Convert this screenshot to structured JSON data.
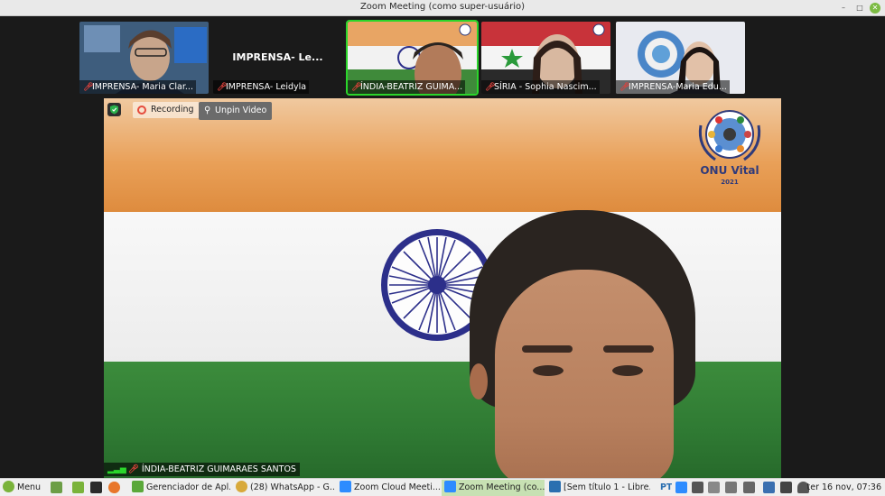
{
  "window": {
    "title": "Zoom Meeting (como super-usuário)"
  },
  "thumbnails": [
    {
      "name": "IMPRENSA- Maria Clar..."
    },
    {
      "big_name": "IMPRENSA- Le...",
      "name": "IMPRENSA- Leidyla"
    },
    {
      "name": "ÍNDIA-BEATRIZ GUIMA..."
    },
    {
      "name": "SÍRIA - Sophia Nascim..."
    },
    {
      "name": "IMPRENSA-Maria Edu..."
    }
  ],
  "main_video": {
    "recording_label": "Recording",
    "unpin_label": "Unpin Video",
    "participant_name": "ÍNDIA-BEATRIZ GUIMARAES SANTOS",
    "logo_title": "ONU Vital",
    "logo_year": "2021"
  },
  "taskbar": {
    "menu_label": "Menu",
    "apps": [
      {
        "label": "Gerenciador de Apl...",
        "icon_color": "#5aa83a"
      },
      {
        "label": "(28) WhatsApp - G...",
        "icon_color": "#d8a93a"
      },
      {
        "label": "Zoom Cloud Meeti...",
        "icon_color": "#2d8cff"
      },
      {
        "label": "Zoom Meeting (co...",
        "icon_color": "#2d8cff"
      },
      {
        "label": "[Sem título 1 - Libre...",
        "icon_color": "#2a6fb0"
      }
    ],
    "language": "PT",
    "clock": "ter 16 nov, 07:36"
  }
}
